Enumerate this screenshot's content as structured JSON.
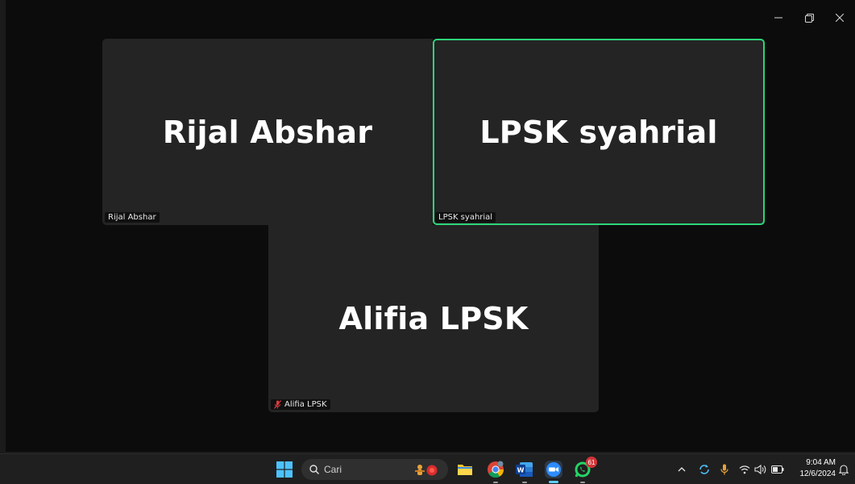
{
  "window": {
    "controls": [
      {
        "name": "minimize-button",
        "icon": "minimize-icon"
      },
      {
        "name": "restore-button",
        "icon": "restore-icon"
      },
      {
        "name": "close-button",
        "icon": "close-icon"
      }
    ]
  },
  "participants": [
    {
      "id": "rijal",
      "display_name": "Rijal Abshar",
      "name_tag": "Rijal Abshar",
      "muted": false,
      "active_speaker": false
    },
    {
      "id": "lpsk",
      "display_name": "LPSK syahrial",
      "name_tag": "LPSK syahrial",
      "muted": false,
      "active_speaker": true
    },
    {
      "id": "alifia",
      "display_name": "Alifia LPSK",
      "name_tag": "Alifia LPSK",
      "muted": true,
      "active_speaker": false
    }
  ],
  "colors": {
    "active_speaker_border": "#2ed47a",
    "muted_icon": "#e0393e",
    "tile_bg": "#242424",
    "taskbar_bg": "#1f1f1f"
  },
  "taskbar": {
    "search_placeholder": "Cari",
    "apps": [
      {
        "name": "start",
        "icon": "windows-logo-icon"
      },
      {
        "name": "file-explorer",
        "icon": "folder-icon"
      },
      {
        "name": "chrome",
        "icon": "chrome-icon"
      },
      {
        "name": "word",
        "icon": "word-icon"
      },
      {
        "name": "zoom",
        "icon": "zoom-icon",
        "active": true
      },
      {
        "name": "whatsapp",
        "icon": "whatsapp-icon",
        "badge": "61"
      }
    ],
    "tray": {
      "icons": [
        "chevron-up-icon",
        "sync-icon",
        "microphone-icon",
        "wifi-icon",
        "volume-icon",
        "battery-icon",
        "notification-bell-icon"
      ],
      "time": "9:04 AM",
      "date": "12/6/2024"
    }
  }
}
